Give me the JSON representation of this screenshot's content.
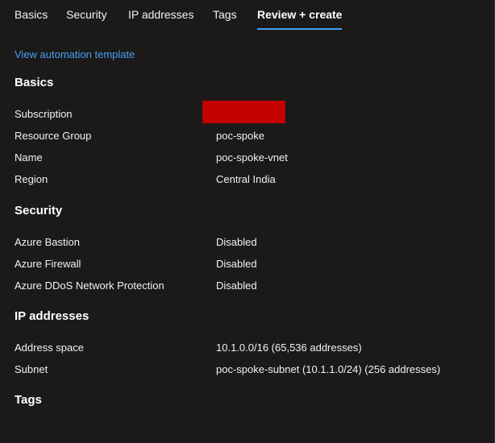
{
  "tabs": [
    {
      "label": "Basics"
    },
    {
      "label": "Security"
    },
    {
      "label": "IP addresses"
    },
    {
      "label": "Tags"
    },
    {
      "label": "Review + create",
      "active": true
    }
  ],
  "automation_link": "View automation template",
  "colors": {
    "background": "#1b1a19",
    "accent": "#479ef5",
    "redaction": "#c50000"
  },
  "sections": {
    "basics": {
      "title": "Basics",
      "rows": [
        {
          "label": "Subscription",
          "value": ""
        },
        {
          "label": "Resource Group",
          "value": "poc-spoke"
        },
        {
          "label": "Name",
          "value": "poc-spoke-vnet"
        },
        {
          "label": "Region",
          "value": "Central India"
        }
      ]
    },
    "security": {
      "title": "Security",
      "rows": [
        {
          "label": "Azure Bastion",
          "value": "Disabled"
        },
        {
          "label": "Azure Firewall",
          "value": "Disabled"
        },
        {
          "label": "Azure DDoS Network Protection",
          "value": "Disabled"
        }
      ]
    },
    "ip_addresses": {
      "title": "IP addresses",
      "rows": [
        {
          "label": "Address space",
          "value": "10.1.0.0/16 (65,536 addresses)"
        },
        {
          "label": "Subnet",
          "value": "poc-spoke-subnet (10.1.1.0/24) (256 addresses)"
        }
      ]
    },
    "tags": {
      "title": "Tags"
    }
  }
}
